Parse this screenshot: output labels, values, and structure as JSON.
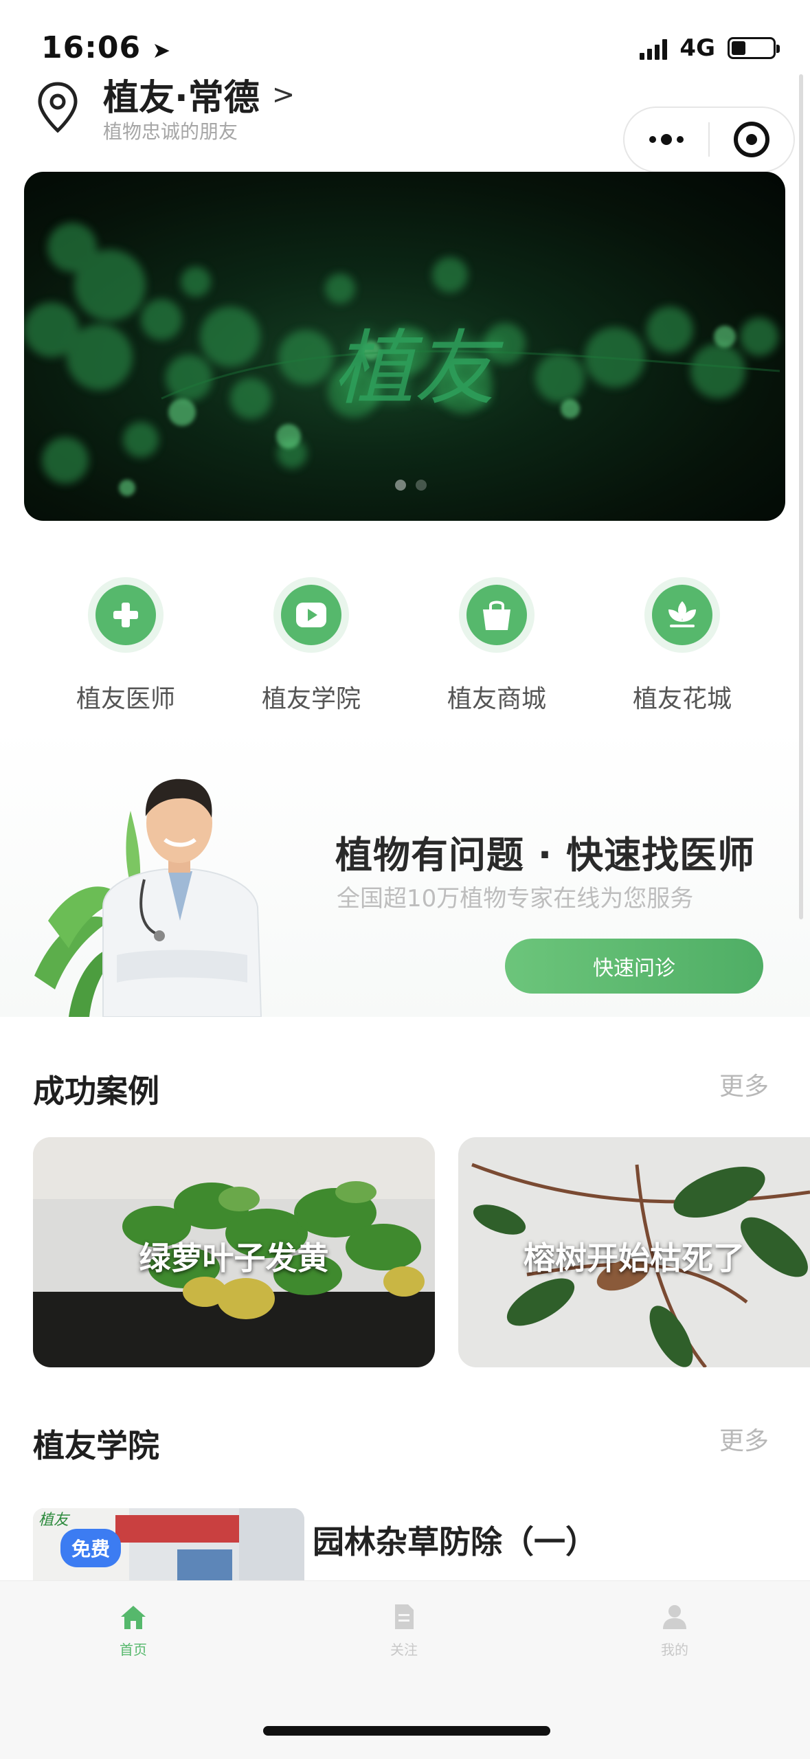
{
  "status_bar": {
    "time": "16:06",
    "time_icon": "location-arrow-icon",
    "network": "4G",
    "battery_level": 0.35
  },
  "header": {
    "title": "植友·常德",
    "subtitle": "植物忠诚的朋友",
    "location_icon": "map-pin-icon",
    "more_icon": "more-dots-icon",
    "close_icon": "target-circle-icon"
  },
  "banner": {
    "brand_text": "植友",
    "slide_count": 2,
    "active_slide": 1
  },
  "quick_entries": [
    {
      "label": "植友医师",
      "icon": "medical-cross-icon"
    },
    {
      "label": "植友学院",
      "icon": "video-play-icon"
    },
    {
      "label": "植友商城",
      "icon": "shopping-bag-icon"
    },
    {
      "label": "植友花城",
      "icon": "lotus-flower-icon"
    }
  ],
  "promo": {
    "title": "植物有问题 · 快速找医师",
    "subtitle": "全国超10万植物专家在线为您服务",
    "button": "快速问诊"
  },
  "cases": {
    "title": "成功案例",
    "more": "更多",
    "items": [
      {
        "label": "绿萝叶子发黄"
      },
      {
        "label": "榕树开始枯死了"
      }
    ]
  },
  "academy": {
    "title": "植友学院",
    "more": "更多",
    "items": [
      {
        "title": "园林杂草防除（一）",
        "badge": "免费"
      }
    ]
  },
  "tabbar": {
    "items": [
      {
        "label": "首页",
        "icon": "home-icon",
        "active": true
      },
      {
        "label": "关注",
        "icon": "document-icon",
        "active": false
      },
      {
        "label": "我的",
        "icon": "user-icon",
        "active": false
      }
    ]
  },
  "colors": {
    "accent": "#56b86c",
    "button": "#5cb872",
    "badge": "#3c7cf2",
    "text_primary": "#222222",
    "text_muted": "#b8b8b8"
  }
}
